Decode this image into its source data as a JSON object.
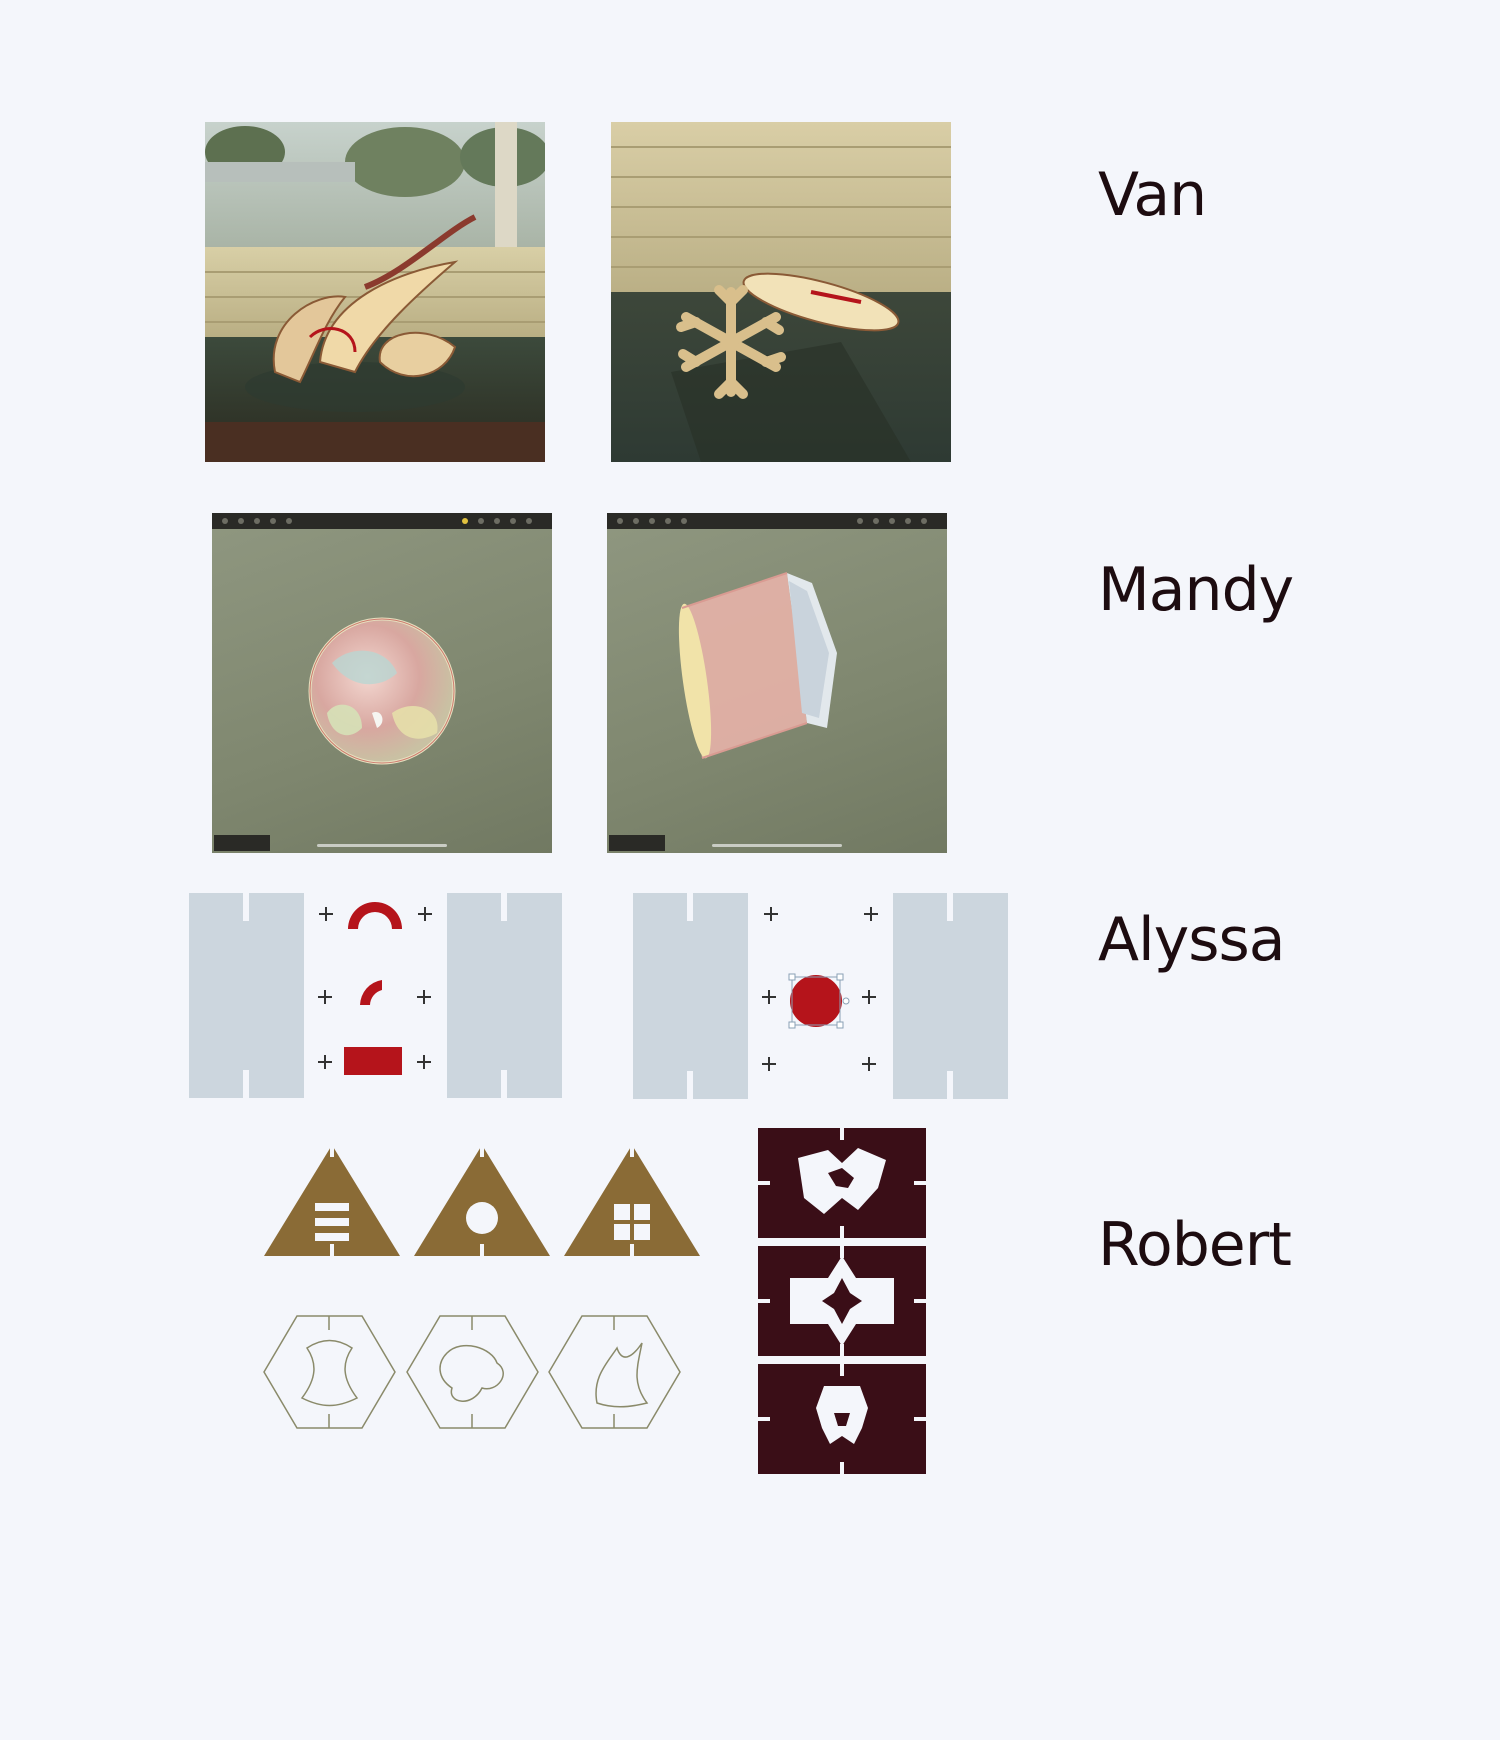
{
  "rows": [
    {
      "name": "Van"
    },
    {
      "name": "Mandy"
    },
    {
      "name": "Alyssa"
    },
    {
      "name": "Robert"
    }
  ],
  "colors": {
    "background": "#f4f6fb",
    "text": "#1d0c10",
    "accent_red": "#b5141b",
    "tile_brown": "#8a6b36",
    "panel_dark": "#3a0e17",
    "panel_light": "#ccd6de",
    "app_view": "#8a917a"
  },
  "icons": [
    "registration-mark-icon",
    "snowflake-icon"
  ]
}
